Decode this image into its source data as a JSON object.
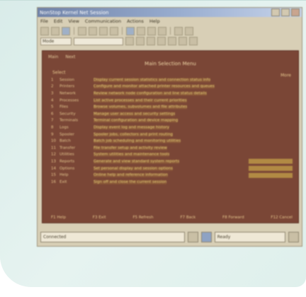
{
  "window": {
    "title": "NonStop Kernel Net Session"
  },
  "menu": [
    "File",
    "Edit",
    "View",
    "Communication",
    "Actions",
    "Help"
  ],
  "toolbar2": {
    "combo_value": "Mode"
  },
  "document": {
    "header_items": [
      "Main",
      "Next"
    ],
    "title": "Main Selection Menu",
    "top_left": "Select",
    "top_right": "More",
    "rows": [
      {
        "num": "1",
        "label": "Session",
        "desc": "Display current session statistics and connection status info"
      },
      {
        "num": "2",
        "label": "Printers",
        "desc": "Configure and monitor attached printer resources and queues"
      },
      {
        "num": "3",
        "label": "Network",
        "desc": "Review network node configuration and line status details"
      },
      {
        "num": "4",
        "label": "Processes",
        "desc": "List active processes and their current priorities"
      },
      {
        "num": "5",
        "label": "Files",
        "desc": "Browse volumes, subvolumes and file attributes"
      },
      {
        "num": "6",
        "label": "Security",
        "desc": "Manage user access and security settings"
      },
      {
        "num": "7",
        "label": "Terminals",
        "desc": "Terminal configuration and device mapping"
      },
      {
        "num": "8",
        "label": "Logs",
        "desc": "Display event log and message history"
      },
      {
        "num": "9",
        "label": "Spooler",
        "desc": "Spooler jobs, collectors and print routing"
      },
      {
        "num": "10",
        "label": "Batch",
        "desc": "Batch job scheduling and monitoring utilities"
      },
      {
        "num": "11",
        "label": "Transfer",
        "desc": "File transfer setup and activity review"
      },
      {
        "num": "12",
        "label": "Utilities",
        "desc": "System utilities and maintenance tools"
      },
      {
        "num": "13",
        "label": "Reports",
        "desc": "Generate and view standard system reports"
      },
      {
        "num": "14",
        "label": "Options",
        "desc": "Set personal display and session options"
      },
      {
        "num": "15",
        "label": "Help",
        "desc": "Online help and reference information"
      },
      {
        "num": "16",
        "label": "Exit",
        "desc": "Sign off and close the current session"
      }
    ],
    "footer": [
      "F1 Help",
      "F3 Exit",
      "F5 Refresh",
      "F7 Back",
      "F8 Forward",
      "F12 Cancel"
    ]
  },
  "status": {
    "left_field": "Connected",
    "right_field": "Ready"
  }
}
